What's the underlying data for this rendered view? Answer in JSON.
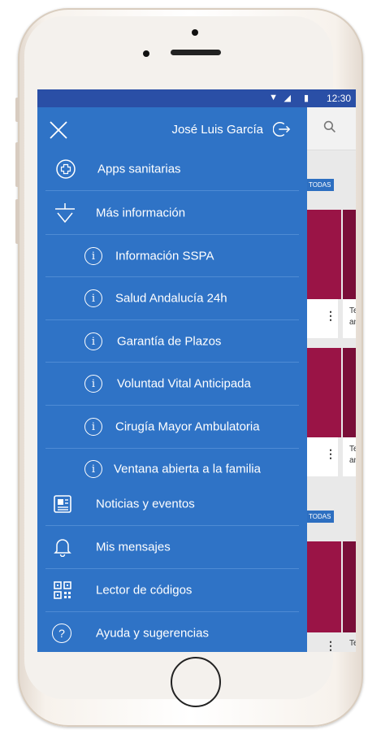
{
  "status_bar": {
    "time": "12:30"
  },
  "drawer": {
    "user_name": "José Luis García",
    "items": [
      {
        "label": "Apps sanitarias",
        "icon": "plus-circle-icon"
      },
      {
        "label": "Más información",
        "icon": "chevron-down-icon"
      },
      {
        "label": "Información SSPA",
        "icon": "info-icon"
      },
      {
        "label": "Salud Andalucía 24h",
        "icon": "info-icon"
      },
      {
        "label": "Garantía de Plazos",
        "icon": "info-icon"
      },
      {
        "label": "Voluntad Vital Anticipada",
        "icon": "info-icon"
      },
      {
        "label": "Cirugía Mayor Ambulatoria",
        "icon": "info-icon"
      },
      {
        "label": "Ventana abierta a la familia",
        "icon": "info-icon"
      },
      {
        "label": "Noticias y eventos",
        "icon": "newspaper-icon"
      },
      {
        "label": "Mis mensajes",
        "icon": "bell-icon"
      },
      {
        "label": "Lector de códigos",
        "icon": "qr-code-icon"
      },
      {
        "label": "Ayuda y sugerencias",
        "icon": "help-icon"
      }
    ]
  },
  "background": {
    "tag_1": "TODAS",
    "tag_2": "TODAS",
    "card_text_1": "Te\nan",
    "card_text_2": "Te\nan",
    "card_text_3": "Te"
  },
  "colors": {
    "drawer": "#2f73c6",
    "status_bar": "#2a4fa6",
    "accent_card": "#9a1446"
  }
}
